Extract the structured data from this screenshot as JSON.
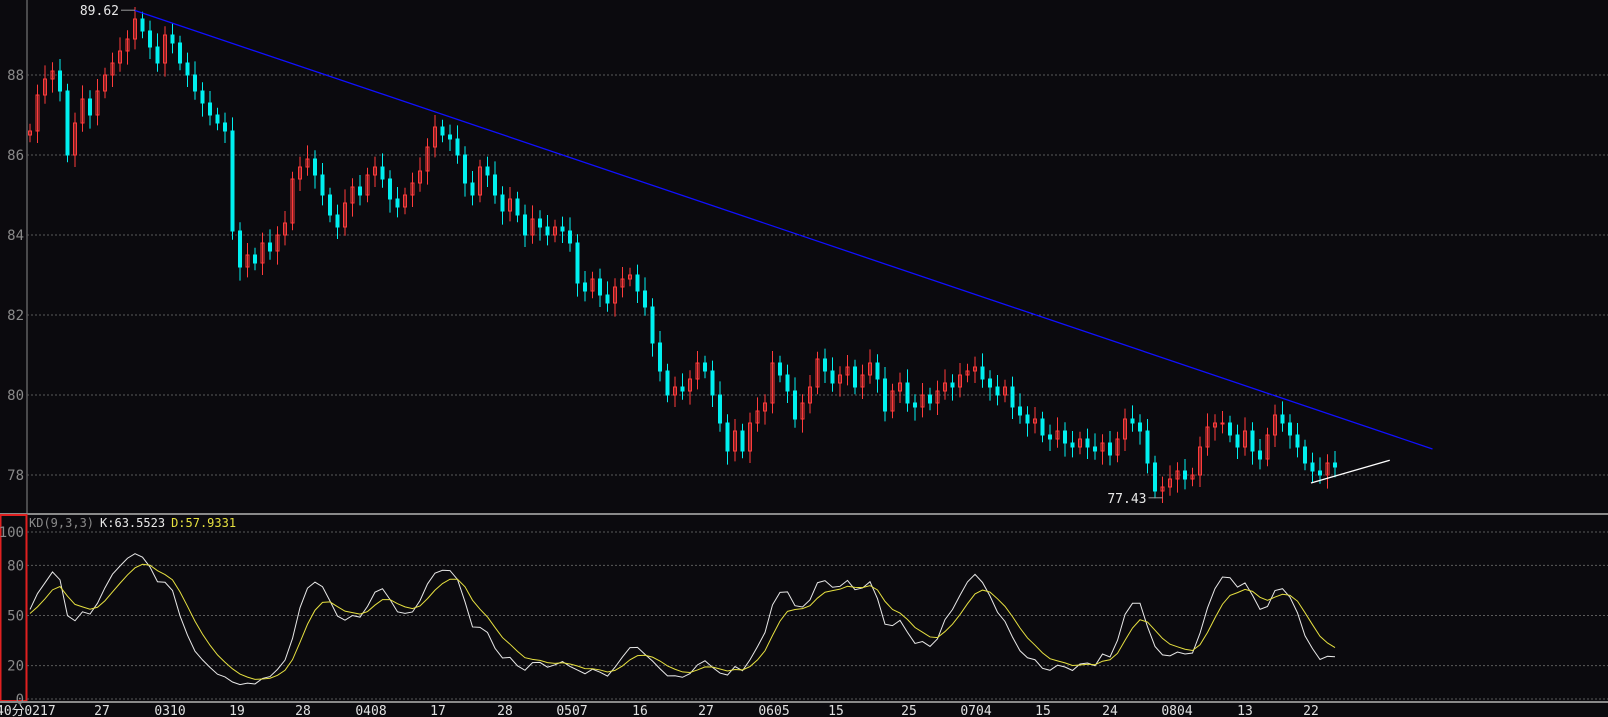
{
  "colors": {
    "background": "#0b0a0e",
    "up": "#ff3b3b",
    "down": "#00f0f0",
    "grid": "#5a5a5a",
    "k_line": "#e8e8e8",
    "d_line": "#e6e040",
    "trendline_main": "#1010ff",
    "trendline_support": "#ffffff",
    "panel_border": "#e02020"
  },
  "period_label": "40分",
  "chart_data": [
    {
      "type": "candlestick",
      "grid": true,
      "ylim": [
        77,
        89.9
      ],
      "yticks": [
        78,
        80,
        82,
        84,
        86,
        88
      ],
      "xticks": [
        "0217",
        "27",
        "0310",
        "19",
        "28",
        "0408",
        "17",
        "28",
        "0507",
        "16",
        "27",
        "0605",
        "15",
        "25",
        "0704",
        "15",
        "24",
        "0804",
        "13",
        "22"
      ],
      "closes": [
        86.6,
        87.5,
        87.9,
        88.1,
        87.6,
        86.0,
        86.8,
        87.4,
        87.0,
        87.6,
        88.0,
        88.3,
        88.6,
        88.9,
        89.4,
        89.1,
        88.7,
        88.3,
        89.0,
        88.8,
        88.3,
        88.0,
        87.6,
        87.3,
        87.0,
        86.8,
        86.6,
        84.1,
        83.2,
        83.5,
        83.3,
        83.8,
        83.6,
        84.0,
        84.3,
        85.4,
        85.7,
        85.9,
        85.5,
        85.0,
        84.5,
        84.2,
        84.8,
        85.2,
        85.0,
        85.5,
        85.7,
        85.4,
        84.9,
        84.7,
        85.0,
        85.3,
        85.6,
        86.2,
        86.7,
        86.5,
        86.4,
        86.0,
        85.3,
        85.0,
        85.7,
        85.5,
        85.0,
        84.6,
        84.9,
        84.5,
        84.0,
        84.4,
        84.2,
        84.0,
        84.2,
        84.1,
        83.8,
        82.8,
        82.6,
        82.9,
        82.5,
        82.3,
        82.7,
        82.9,
        83.0,
        82.6,
        82.2,
        81.3,
        80.6,
        80.0,
        80.2,
        80.1,
        80.4,
        80.8,
        80.6,
        80.0,
        79.3,
        78.6,
        79.1,
        78.6,
        79.3,
        79.6,
        79.8,
        80.8,
        80.5,
        80.1,
        79.4,
        79.8,
        80.2,
        80.9,
        80.6,
        80.3,
        80.5,
        80.7,
        80.2,
        80.5,
        80.8,
        80.4,
        79.6,
        80.1,
        80.3,
        79.8,
        79.7,
        80.0,
        79.8,
        80.1,
        80.3,
        80.2,
        80.5,
        80.6,
        80.7,
        80.4,
        80.2,
        80.0,
        80.2,
        79.7,
        79.5,
        79.3,
        79.4,
        79.0,
        78.9,
        79.1,
        78.8,
        78.7,
        78.9,
        78.7,
        78.6,
        78.8,
        78.5,
        78.9,
        79.4,
        79.3,
        79.1,
        78.3,
        77.6,
        77.7,
        77.9,
        78.1,
        77.9,
        78.0,
        78.7,
        79.2,
        79.3,
        79.3,
        79.0,
        78.7,
        79.1,
        78.6,
        78.4,
        79.0,
        79.5,
        79.3,
        79.0,
        78.7,
        78.3,
        78.1,
        78.0,
        78.3,
        78.2
      ],
      "annotations": [
        {
          "text": "89.62",
          "value": 89.62,
          "bar": 14,
          "kind": "high"
        },
        {
          "text": "77.43",
          "value": 77.43,
          "bar": 151,
          "kind": "low"
        }
      ],
      "trendlines": [
        {
          "name": "resistance",
          "from": [
            13.9,
            89.62
          ],
          "to": [
            187,
            78.65
          ]
        },
        {
          "name": "support",
          "from": [
            170.8,
            77.8
          ],
          "to": [
            181.3,
            78.37
          ]
        }
      ]
    },
    {
      "type": "line",
      "title": "KD(9,3,3)",
      "grid": true,
      "ylim": [
        0,
        100
      ],
      "yticks": [
        0,
        20,
        50,
        80,
        100
      ],
      "legend": {
        "k_text": "K:63.5523",
        "d_text": "D:57.9331"
      },
      "series": [
        {
          "name": "K",
          "last": 63.5523
        },
        {
          "name": "D",
          "last": 57.9331
        }
      ]
    }
  ]
}
